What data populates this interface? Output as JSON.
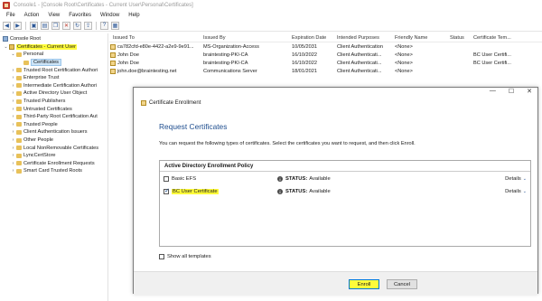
{
  "window": {
    "title": "Console1 - [Console Root\\Certificates - Current User\\Personal\\Certificates]"
  },
  "menu": [
    "File",
    "Action",
    "View",
    "Favorites",
    "Window",
    "Help"
  ],
  "toolbar": {
    "icons": [
      "back-icon",
      "forward-icon",
      "up-icon",
      "show-tree-icon",
      "copy-icon",
      "delete-icon",
      "refresh-icon",
      "export-icon",
      "help-icon",
      "properties-icon"
    ]
  },
  "tree": {
    "root": "Console Root",
    "store": "Certificates - Current User",
    "personal": "Personal",
    "certificates": "Certificates",
    "items": [
      "Trusted Root Certification Authori",
      "Enterprise Trust",
      "Intermediate Certification Authori",
      "Active Directory User Object",
      "Trusted Publishers",
      "Untrusted Certificates",
      "Third-Party Root Certification Aut",
      "Trusted People",
      "Client Authentication Issuers",
      "Other People",
      "Local NonRemovable Certificates",
      "LyncCertStore",
      "Certificate Enrollment Requests",
      "Smart Card Trusted Roots"
    ]
  },
  "list": {
    "headers": [
      "Issued To",
      "Issued By",
      "Expiration Date",
      "Intended Purposes",
      "Friendly Name",
      "Status",
      "Certificate Tem..."
    ],
    "rows": [
      [
        "ca782cfd-e80e-4422-a2e9-9e91...",
        "MS-Organization-Access",
        "10/05/2031",
        "Client Authentication",
        "<None>",
        "",
        ""
      ],
      [
        "John Doe",
        "braintesting-PKI-CA",
        "16/10/2022",
        "Client Authenticati...",
        "<None>",
        "",
        "BC User Certifi..."
      ],
      [
        "John Doe",
        "braintesting-PKI-CA",
        "16/10/2022",
        "Client Authenticati...",
        "<None>",
        "",
        "BC User Certifi..."
      ],
      [
        "john.doe@braintesting.net",
        "Communications Server",
        "18/01/2021",
        "Client Authenticati...",
        "<None>",
        "",
        ""
      ]
    ]
  },
  "dialog": {
    "title": "Certificate Enrollment",
    "heading": "Request Certificates",
    "description": "You can request the following types of certificates. Select the certificates you want to request, and then click Enroll.",
    "policy": "Active Directory Enrollment Policy",
    "templates": [
      {
        "name": "Basic EFS",
        "checked": false,
        "status_key": "STATUS:",
        "status": "Available",
        "details": "Details"
      },
      {
        "name": "BC User Certificate",
        "checked": true,
        "status_key": "STATUS:",
        "status": "Available",
        "details": "Details"
      }
    ],
    "show_all": "Show all templates",
    "enroll": "Enroll",
    "cancel": "Cancel"
  },
  "colors": {
    "highlight": "#fffb3a",
    "heading": "#1f4e8f",
    "selection": "#cce4f7"
  }
}
